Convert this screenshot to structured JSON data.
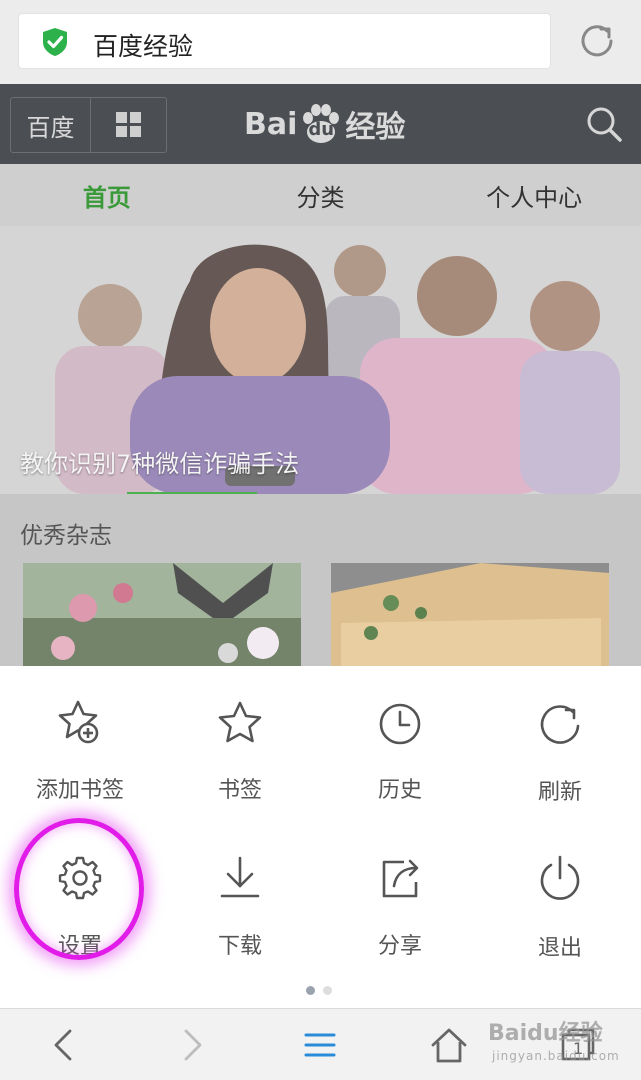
{
  "address_bar": {
    "title": "百度经验"
  },
  "header": {
    "baidu_button": "百度",
    "logo_text_left": "Bai",
    "logo_text_du": "du",
    "logo_text_right": "经验"
  },
  "tabs": [
    {
      "label": "首页",
      "active": true
    },
    {
      "label": "分类",
      "active": false
    },
    {
      "label": "个人中心",
      "active": false
    }
  ],
  "banner": {
    "caption": "教你识别7种微信诈骗手法"
  },
  "section": {
    "title": "优秀杂志"
  },
  "menu": {
    "items": [
      {
        "label": "添加书签",
        "icon": "add-bookmark-icon"
      },
      {
        "label": "书签",
        "icon": "star-icon"
      },
      {
        "label": "历史",
        "icon": "clock-icon"
      },
      {
        "label": "刷新",
        "icon": "refresh-icon"
      },
      {
        "label": "设置",
        "icon": "gear-icon"
      },
      {
        "label": "下载",
        "icon": "download-icon"
      },
      {
        "label": "分享",
        "icon": "share-icon"
      },
      {
        "label": "退出",
        "icon": "power-icon"
      }
    ],
    "page_count": 2,
    "current_page": 1
  },
  "watermark": {
    "brand": "Bai",
    "brand_du": "du",
    "brand_cn": "经验",
    "url": "jingyan.baidu.com"
  },
  "colors": {
    "accent_green": "#3a9a3a",
    "header_bg": "#4b4e53",
    "highlight": "#e21ce8"
  }
}
